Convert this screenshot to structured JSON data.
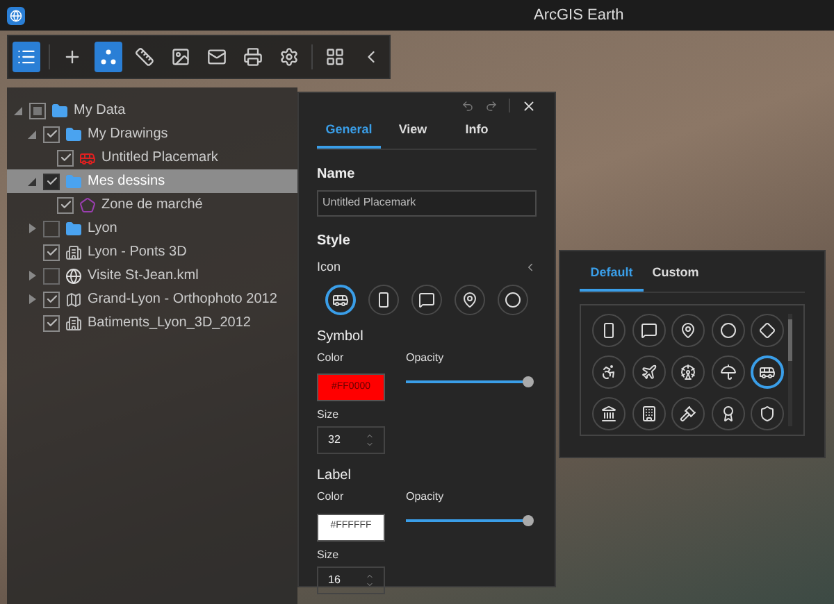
{
  "window": {
    "title": "ArcGIS Earth"
  },
  "toolbar": [
    {
      "selected": true
    },
    {
      "selected": false
    },
    {
      "selected": true
    },
    {
      "selected": false
    },
    {
      "selected": false
    },
    {
      "selected": false
    },
    {
      "selected": false
    },
    {
      "selected": false
    },
    {
      "selected": false
    },
    {
      "selected": false
    }
  ],
  "tree": [
    {
      "label": "My Data",
      "kind": "folder",
      "checked": true,
      "partial": true,
      "expanded": true,
      "selected": false,
      "children": [
        {
          "label": "My Drawings",
          "kind": "folder",
          "checked": true,
          "partial": false,
          "expanded": true,
          "selected": false,
          "children": [
            {
              "label": "Untitled Placemark",
              "kind": "placemark",
              "checked": true,
              "partial": false,
              "selected": false
            }
          ]
        },
        {
          "label": "Mes dessins",
          "kind": "folder",
          "checked": true,
          "partial": false,
          "expanded": true,
          "selected": true,
          "children": [
            {
              "label": "Zone de marché",
              "kind": "polygon",
              "checked": true,
              "partial": false,
              "selected": false
            }
          ]
        },
        {
          "label": "Lyon",
          "kind": "folder",
          "checked": false,
          "partial": false,
          "expanded": false,
          "selected": false
        },
        {
          "label": "Lyon - Ponts 3D",
          "kind": "layer",
          "checked": true,
          "partial": false,
          "selected": false
        },
        {
          "label": "Visite St-Jean.kml",
          "kind": "kml",
          "checked": false,
          "partial": false,
          "expanded": false,
          "selected": false
        },
        {
          "label": "Grand-Lyon - Orthophoto 2012",
          "kind": "map",
          "checked": true,
          "partial": false,
          "expanded": false,
          "selected": false
        },
        {
          "label": "Batiments_Lyon_3D_2012",
          "kind": "layer",
          "checked": true,
          "partial": false,
          "selected": false
        }
      ]
    }
  ],
  "properties": {
    "tabs": [
      {
        "label": "General",
        "selected": true
      },
      {
        "label": "View",
        "selected": false
      },
      {
        "label": "Info",
        "selected": false
      }
    ],
    "name_heading": "Name",
    "name_value": "Untitled Placemark",
    "style_heading": "Style",
    "icon_label": "Icon",
    "icon_options": [
      {
        "selected": true
      },
      {
        "selected": false
      },
      {
        "selected": false
      },
      {
        "selected": false
      },
      {
        "selected": false
      }
    ],
    "sections": [
      {
        "heading": "Symbol",
        "color_label": "Color",
        "color_value": "#FF0000",
        "color": "#ff0000",
        "opacity_label": "Opacity",
        "level": 1,
        "size_label": "Size",
        "size": "32"
      },
      {
        "heading": "Label",
        "color_label": "Color",
        "color_value": "#FFFFFF",
        "color": "#ffffff",
        "opacity_label": "Opacity",
        "level": 1,
        "size_label": "Size",
        "size": "16"
      }
    ]
  },
  "picker": {
    "tabs": [
      {
        "label": "Default",
        "selected": true
      },
      {
        "label": "Custom",
        "selected": false
      }
    ],
    "icons": [
      {
        "selected": false
      },
      {
        "selected": false
      },
      {
        "selected": false
      },
      {
        "selected": false
      },
      {
        "selected": false
      },
      {
        "selected": false
      },
      {
        "selected": false
      },
      {
        "selected": false
      },
      {
        "selected": false
      },
      {
        "selected": true
      },
      {
        "selected": false
      },
      {
        "selected": false
      },
      {
        "selected": false
      },
      {
        "selected": false
      },
      {
        "selected": false
      }
    ]
  }
}
